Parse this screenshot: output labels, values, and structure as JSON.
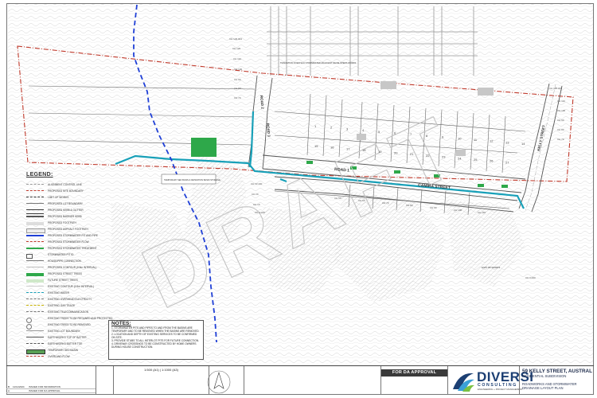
{
  "drawing": {
    "watermark": "DRAFT",
    "street_labels": {
      "kelly_street": "KELLY STREET",
      "road_1": "ROAD 1",
      "road_2": "ROAD 2",
      "road_3": "ROAD 3",
      "camira_street": "CAMIRA STREET"
    },
    "callouts": {
      "transition": "TRANSITION OVER SAU STORMWATER ADJACENT DEVELOPERS WORKS",
      "basin": "TEMPORARY SED BASIN & DETENTION BASIN STORAGE",
      "temporary": "TEMPORARY",
      "limit_of_works": "LIMIT OF WORKS"
    },
    "chainages": [
      "CH 129.944",
      "CH 120",
      "CH 110",
      "CH 100",
      "CH 90",
      "CH 80",
      "CH 70",
      "CH 125.000",
      "CH 110",
      "CH 100",
      "CH 90",
      "CH 80",
      "CH 70",
      "CH 22.430",
      "CH 20",
      "CH 10",
      "CH 0.000",
      "CH 0.000",
      "CH 50",
      "CH 60",
      "CH 70",
      "CH 80",
      "CH 90",
      "CH 100",
      "CH 110"
    ],
    "lot_numbers": [
      "1",
      "2",
      "3",
      "4",
      "5",
      "6",
      "7",
      "8",
      "9",
      "10",
      "11",
      "12",
      "13",
      "14",
      "15",
      "16",
      "17",
      "18",
      "19",
      "20",
      "21",
      "22",
      "23",
      "24",
      "25",
      "26",
      "27"
    ]
  },
  "legend": {
    "title": "LEGEND:",
    "items": [
      "ALIGNMENT CONTROL LINE",
      "PROPOSED SITE BOUNDARY",
      "LIMIT OF WORKS",
      "PROPOSED LOT BOUNDARY",
      "PROPOSED KERB & GUTTER",
      "PROPOSED BARRIER KERB",
      "PROPOSED FOOTPATH",
      "PROPOSED ASPHALT FOOTPATH",
      "PROPOSED STORMWATER PIT AND PIPE",
      "PROPOSED STORMWATER FLOW",
      "PROPOSED STORMWATER TREATMENT",
      "STORMWATER PIT ID",
      "HOUSE/PIPE CONNECTION",
      "PROPOSED CONTOUR (0.5m INTERVAL)",
      "PROPOSED STREET TREES",
      "FUTURE STREET TREES",
      "EXISTING CONTOUR (0.5m INTERVAL)",
      "EXISTING WATER",
      "EXISTING OVERHEAD ELECTRICITY",
      "EXISTING GAS TRACE",
      "EXISTING TELECOMMUNICATION",
      "EXISTING TREES TO BE RETAINED AND PROTECTED",
      "EXISTING TREES TO BE REMOVED",
      "EXISTING LOT BOUNDARY",
      "EARTHWORKS TOP OF BATTER",
      "EARTHWORKS BATTER TOE",
      "TEMPORARY SED BASIN",
      "OVERLAND FLOW"
    ]
  },
  "notes": {
    "title": "NOTES:",
    "items": [
      "1. STORMWATER PITS AND PIPES TO AND FROM THE BASINS ARE TEMPORARY AND TO BE REMOVED WHEN THE BASINS ARE REMOVED.",
      "2. LOCATION AND DEPTH OF EXISTING SERVICES TO BE CONFIRMED ON SITE.",
      "3. PROVIDE STUBS TO ALL INTERLOT PITS FOR FUTURE CONNECTION.",
      "4. DRIVEWAY CROSSINGS TO BE CONSTRUCTED BY HOME OWNERS DURING HOUSE CONSTRUCTION."
    ]
  },
  "title_block": {
    "revisions": [
      {
        "rev": "B",
        "date": "11/11/2024",
        "desc": "ISSUED FOR INFORMATION"
      },
      {
        "rev": "A",
        "date": "",
        "desc": "ISSUED FOR DA APPROVAL"
      }
    ],
    "scale": "1:500 (A1) | 1:1000 (A3)",
    "approval": "FOR DA APPROVAL",
    "company": "DIVERSI",
    "company_sub": "CONSULTING",
    "company_tagline": "ENGINEERING + PROJECT MANAGEMENT",
    "project_title": "59 KELLY STREET, AUSTRAL",
    "project_sub": "RESIDENTIAL SUBDIVISION",
    "drawing_title": "ROADWORKS AND STORMWATER DRAINAGE LAYOUT PLAN"
  },
  "colors": {
    "boundary": "#c0392b",
    "stormwater": "#18a0b8",
    "sewer": "#1f3fd6",
    "basin": "#2ea84a",
    "treatment": "#2ea84a"
  }
}
